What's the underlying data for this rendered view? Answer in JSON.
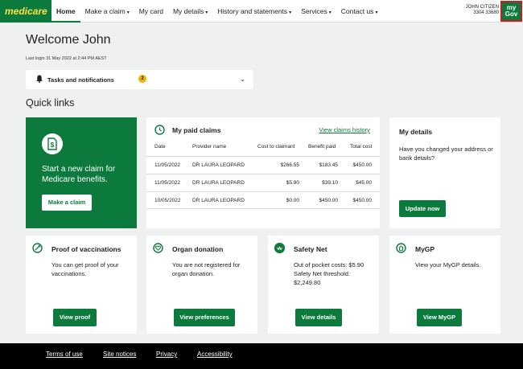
{
  "header": {
    "logo": "medicare",
    "nav": [
      {
        "label": "Home"
      },
      {
        "label": "Make a claim",
        "caret": "▾"
      },
      {
        "label": "My card"
      },
      {
        "label": "My details",
        "caret": "▾"
      },
      {
        "label": "History and statements",
        "caret": "▾"
      },
      {
        "label": "Services",
        "caret": "▾"
      },
      {
        "label": "Contact us",
        "caret": "▾"
      }
    ],
    "user_name": "JOHN CITIZEN",
    "user_number": "3304 33680",
    "mygov_top": "my",
    "mygov_bottom": "Gov"
  },
  "welcome": "Welcome John",
  "last_login": "Last login 31 May 2022 at 2:44 PM AEST",
  "tasks": {
    "label": "Tasks and notifications",
    "count": "2",
    "chevron": "⌄"
  },
  "quick_links_title": "Quick links",
  "new_claim": {
    "text": "Start a new claim for Medicare benefits.",
    "button": "Make a claim"
  },
  "claims": {
    "title": "My paid claims",
    "link": "View claims history",
    "headers": [
      "Date",
      "Provider name",
      "Cost to claimant",
      "Benefit paid",
      "Total cost"
    ],
    "rows": [
      [
        "11/05/2022",
        "DR LAURA LEOPARD",
        "$266.55",
        "$183.45",
        "$450.00"
      ],
      [
        "11/05/2022",
        "DR LAURA LEOPARD",
        "$5.90",
        "$39.10",
        "$45.00"
      ],
      [
        "10/05/2022",
        "DR LAURA LEOPARD",
        "$0.00",
        "$450.00",
        "$450.00"
      ]
    ]
  },
  "my_details": {
    "title": "My details",
    "text": "Have you changed your address or bank details?",
    "button": "Update now"
  },
  "cards": [
    {
      "title": "Proof of vaccinations",
      "text": "You can get proof of your vaccinations.",
      "button": "View proof",
      "icon": "syringe-icon"
    },
    {
      "title": "Organ donation",
      "text": "You are not registered for organ donation.",
      "button": "View preferences",
      "icon": "heart-icon"
    },
    {
      "title": "Safety Net",
      "text_line1": "Out of pocket costs: $5.90",
      "text_line2": "Safety Net threshold: $2,249.80",
      "button": "View details",
      "icon": "safety-net-icon"
    },
    {
      "title": "MyGP",
      "text": "View your MyGP details.",
      "button": "View MyGP",
      "icon": "house-icon"
    }
  ],
  "footer": [
    "Terms of use",
    "Site notices",
    "Privacy",
    "Accessibility"
  ],
  "colors": {
    "brand_green": "#0b7a3c",
    "logo_yellow": "#ffe14a",
    "badge": "#f2b400",
    "mygov_border": "#d21a1a"
  }
}
